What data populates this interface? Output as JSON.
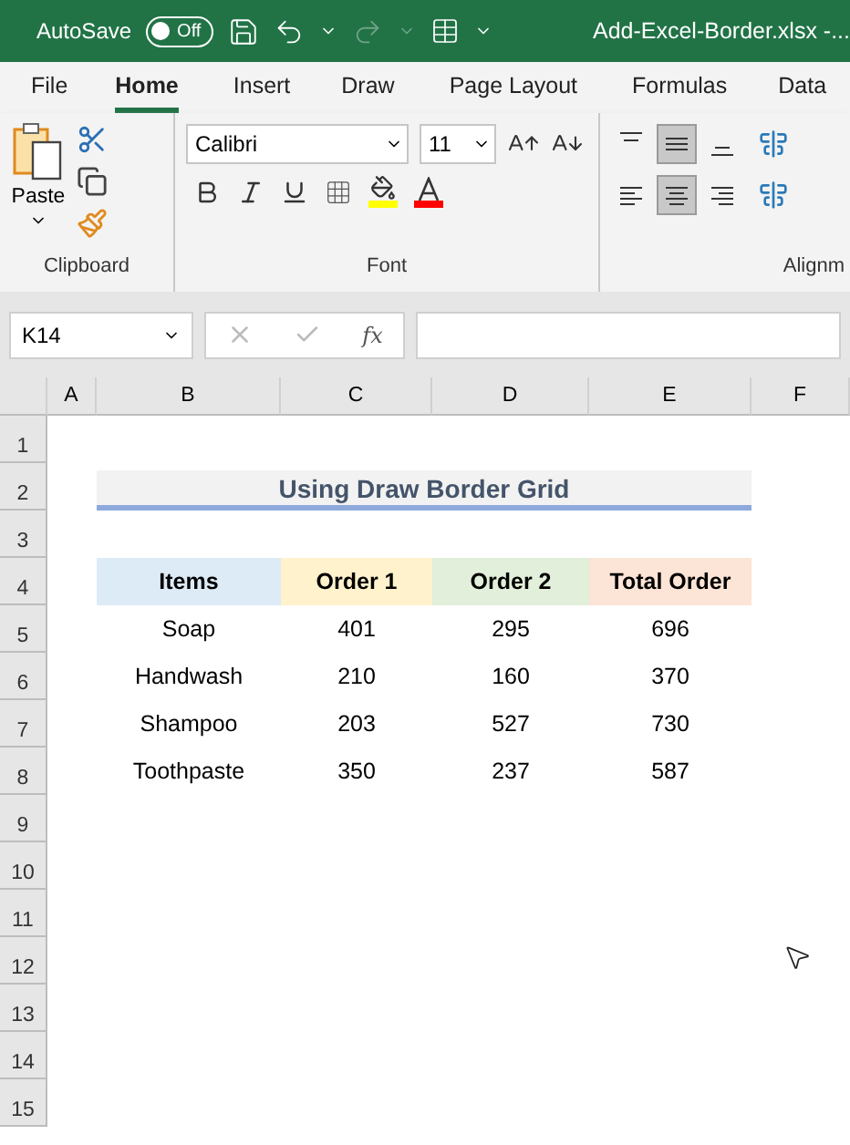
{
  "title_bar": {
    "autosave_label": "AutoSave",
    "autosave": {
      "label": "Off",
      "on": false
    },
    "redo_disabled": true,
    "file_name": "Add-Excel-Border.xlsx  -..."
  },
  "tabs": [
    {
      "label": "File",
      "selected": false
    },
    {
      "label": "Home",
      "selected": true
    },
    {
      "label": "Insert",
      "selected": false
    },
    {
      "label": "Draw",
      "selected": false
    },
    {
      "label": "Page Layout",
      "selected": false
    },
    {
      "label": "Formulas",
      "selected": false
    },
    {
      "label": "Data",
      "selected": false
    }
  ],
  "ribbon": {
    "clipboard": {
      "paste_label": "Paste",
      "group_label": "Clipboard"
    },
    "font": {
      "font_name": "Calibri",
      "font_size": "11",
      "group_label": "Font"
    },
    "alignment": {
      "group_label": "Alignm",
      "vertical": [
        {
          "selected": false
        },
        {
          "selected": true
        },
        {
          "selected": false
        }
      ],
      "horizontal": [
        {
          "selected": false
        },
        {
          "selected": true
        },
        {
          "selected": false
        }
      ]
    }
  },
  "formula_bar": {
    "name_box": "K14",
    "fx": "fx"
  },
  "sheet": {
    "columns": [
      "A",
      "B",
      "C",
      "D",
      "E",
      "F"
    ],
    "rows": [
      "1",
      "2",
      "3",
      "4",
      "5",
      "6",
      "7",
      "8",
      "9",
      "10",
      "11",
      "12",
      "13",
      "14",
      "15"
    ],
    "title": "Using Draw Border Grid",
    "headers": [
      {
        "label": "Items",
        "color": "#ddebf7"
      },
      {
        "label": "Order 1",
        "color": "#fff2cc"
      },
      {
        "label": "Order 2",
        "color": "#e2efda"
      },
      {
        "label": "Total Order",
        "color": "#fce4d6"
      }
    ],
    "data": [
      [
        "Soap",
        "401",
        "295",
        "696"
      ],
      [
        "Handwash",
        "210",
        "160",
        "370"
      ],
      [
        "Shampoo",
        "203",
        "527",
        "730"
      ],
      [
        "Toothpaste",
        "350",
        "237",
        "587"
      ]
    ]
  }
}
